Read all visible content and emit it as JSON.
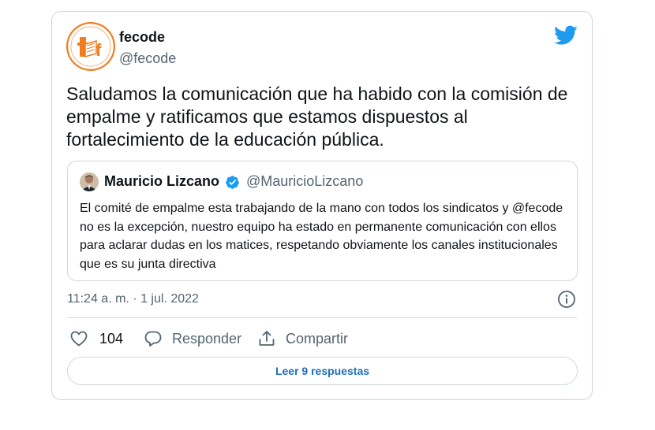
{
  "author": {
    "name": "fecode",
    "handle": "@fecode",
    "logo_letter": "f"
  },
  "tweet": {
    "text": "Saludamos la comunicación que ha habido con la comisión de empalme y ratificamos que estamos dispuestos al fortalecimiento de la educación pública."
  },
  "quoted": {
    "name": "Mauricio Lizcano",
    "handle": "@MauricioLizcano",
    "verified": true,
    "text": "El comité de empalme esta trabajando de la mano con todos los sindicatos y @fecode no es la excepción, nuestro equipo ha estado en permanente comunicación con ellos para aclarar dudas en los matices, respetando obviamente los canales institucionales que es su junta directiva"
  },
  "meta": {
    "timestamp": "11:24 a. m. · 1 jul. 2022"
  },
  "actions": {
    "like_count": "104",
    "reply_label": "Responder",
    "share_label": "Compartir"
  },
  "footer": {
    "read_replies_label": "Leer 9 respuestas"
  },
  "colors": {
    "twitter_blue": "#1d9bf0",
    "brand_orange": "#f07d1e",
    "link_blue": "#1d6fb8",
    "secondary_text": "#536471",
    "border": "#cfd9de"
  },
  "icons": {
    "brand": "twitter-bird-icon",
    "verified": "verified-badge-icon",
    "info": "info-icon",
    "like": "heart-icon",
    "reply": "reply-bubble-icon",
    "share": "share-icon"
  }
}
